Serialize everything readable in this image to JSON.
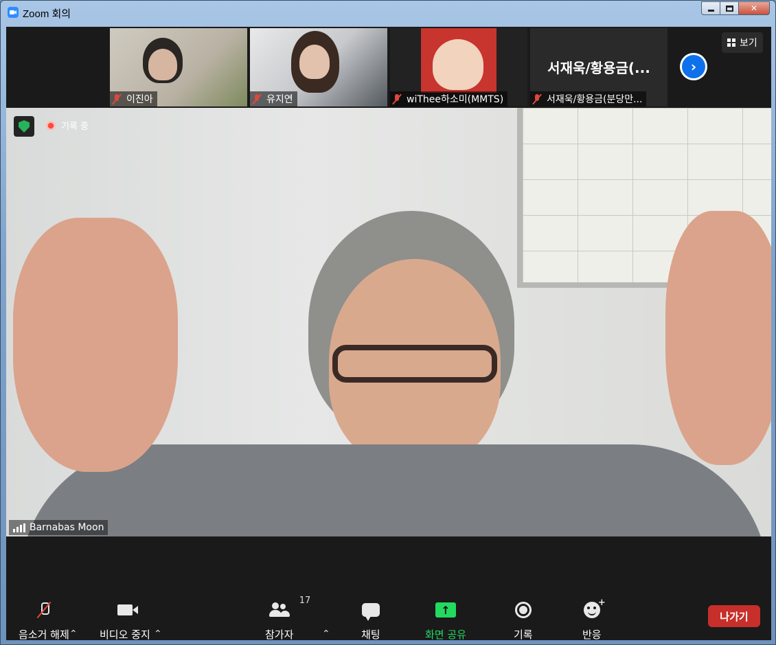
{
  "window": {
    "title": "Zoom 회의"
  },
  "participants_strip": [
    {
      "name": "이진아",
      "muted": true
    },
    {
      "name": "유지연",
      "muted": true
    },
    {
      "name": "wiThee하소미(MMTS)",
      "muted": true
    },
    {
      "name": "서재욱/황용금(분당만...",
      "muted": true,
      "display_title": "서재욱/황용금(..."
    }
  ],
  "view_button": {
    "label": "보기"
  },
  "recording_indicator": {
    "label": "기록 중"
  },
  "active_speaker": {
    "name": "Barnabas Moon"
  },
  "toolbar": {
    "unmute": "음소거 해제",
    "stop_video": "비디오 중지",
    "participants": "참가자",
    "participants_count": "17",
    "chat": "채팅",
    "share_screen": "화면 공유",
    "record": "기록",
    "reactions": "반응",
    "leave": "나가기"
  },
  "colors": {
    "accent_blue": "#0e71eb",
    "share_green": "#23d960",
    "leave_red": "#c72f2b",
    "security_green": "#25b35b"
  }
}
